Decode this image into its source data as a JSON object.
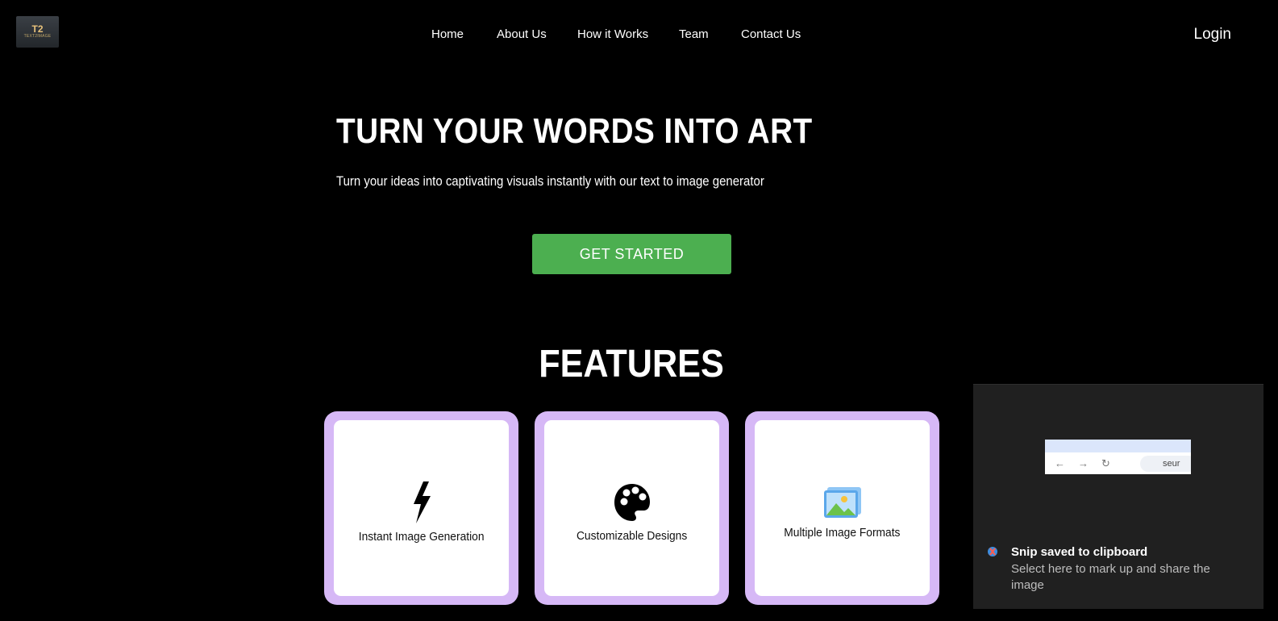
{
  "brand": {
    "logo_mark": "T2",
    "logo_sub": "TEXT2IMAGE"
  },
  "nav": {
    "items": [
      "Home",
      "About Us",
      "How it Works",
      "Team",
      "Contact Us"
    ],
    "login": "Login"
  },
  "hero": {
    "title": "TURN YOUR WORDS INTO ART",
    "subtitle": "Turn your ideas into captivating visuals instantly with our text to image generator",
    "cta": "GET STARTED"
  },
  "features": {
    "title": "FEATURES",
    "cards": [
      {
        "label": "Instant Image Generation",
        "icon": "lightning-icon"
      },
      {
        "label": "Customizable Designs",
        "icon": "palette-icon"
      },
      {
        "label": "Multiple Image Formats",
        "icon": "image-gallery-icon"
      }
    ]
  },
  "colors": {
    "background": "#000000",
    "accent_green": "#4caf50",
    "card_border": "#d6b8f6",
    "toast_bg": "#202020"
  },
  "toast": {
    "title": "Snip saved to clipboard",
    "body": "Select here to mark up and share the image",
    "thumb_text": "seur"
  }
}
